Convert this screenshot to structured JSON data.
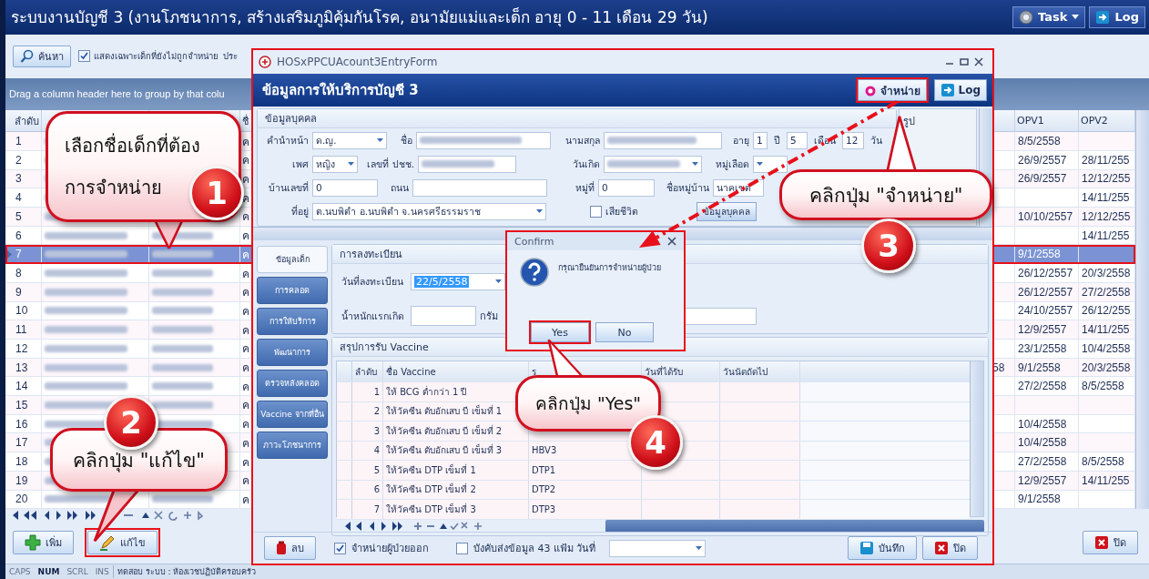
{
  "window": {
    "title": "ระบบงานบัญชี 3 (งานโภชนาการ, สร้างเสริมภูมิคุ้มกันโรค, อนามัยแม่และเด็ก อายุ 0 - 11 เดือน 29 วัน)",
    "buttons": [
      "Task",
      "Log"
    ]
  },
  "toolbar": {
    "search_button": "ค้นหา",
    "filter_checkbox": {
      "label": "แสดงเฉพาะเด็กที่ยังไม่ถูกจำหน่าย",
      "checked": true
    },
    "cut_label": "ประ"
  },
  "group_panel": "Drag a column header here to group by that colu",
  "grid": {
    "columns": [
      "ลำดับ",
      "ชื่",
      "OPV1",
      "OPV2"
    ],
    "rows": [
      {
        "no": "1",
        "column_4": "ค",
        "opv1": "8/5/2558",
        "selected": false
      },
      {
        "no": "2",
        "column_4": "ค",
        "opv1": "26/9/2557",
        "opv2": "28/11/255",
        "selected": false
      },
      {
        "no": "3",
        "column_4": "ค",
        "opv1": "26/9/2557",
        "opv2": "12/12/255",
        "selected": false
      },
      {
        "no": "4",
        "column_4": "ค",
        "opv2": "14/11/255",
        "selected": false
      },
      {
        "no": "5",
        "column_4": "ค",
        "opv1": "10/10/2557",
        "opv2": "12/12/255",
        "selected": false
      },
      {
        "no": "6",
        "column_4": "ค",
        "opv2": "14/11/255",
        "selected": false
      },
      {
        "no": "7",
        "column_4": "ค",
        "opv1": "9/1/2558",
        "selected": true
      },
      {
        "no": "8",
        "column_4": "ค",
        "opv1": "26/12/2557",
        "opv2": "20/3/2558",
        "selected": false
      },
      {
        "no": "9",
        "column_4": "ค",
        "opv1": "26/12/2557",
        "opv2": "27/2/2558",
        "selected": false
      },
      {
        "no": "10",
        "column_4": "ค",
        "opv1": "24/10/2557",
        "opv2": "26/12/255",
        "selected": false
      },
      {
        "no": "11",
        "column_4": "ค",
        "opv1": "12/9/2557",
        "opv2": "14/11/255",
        "selected": false
      },
      {
        "no": "12",
        "column_4": "ค",
        "opv1": "23/1/2558",
        "opv2": "10/4/2558",
        "selected": false
      },
      {
        "no": "13",
        "column_4": "ค",
        "column_5": "58",
        "opv1": "9/1/2558",
        "opv2": "20/3/2558",
        "selected": false
      },
      {
        "no": "14",
        "column_4": "ค",
        "opv1": "27/2/2558",
        "opv2": "8/5/2558",
        "selected": false
      },
      {
        "no": "15",
        "column_4": "ค",
        "selected": false
      },
      {
        "no": "16",
        "column_4": "ค",
        "opv1": "10/4/2558",
        "selected": false
      },
      {
        "no": "17",
        "column_4": "ค",
        "opv1": "10/4/2558",
        "selected": false
      },
      {
        "no": "18",
        "column_4": "ค",
        "opv1": "27/2/2558",
        "opv2": "8/5/2558",
        "selected": false
      },
      {
        "no": "19",
        "column_4": "ค",
        "opv1": "12/9/2557",
        "opv2": "14/11/255",
        "selected": false
      },
      {
        "no": "20",
        "column_4": "ค",
        "opv1": "9/1/2558",
        "selected": false
      }
    ]
  },
  "bottom_buttons": {
    "add": "เพิ่ม",
    "edit": "แก้ไข",
    "close": "ปิด"
  },
  "status_bar": {
    "keys": [
      {
        "label": "CAPS",
        "on": false
      },
      {
        "label": "NUM",
        "on": true
      },
      {
        "label": "SCRL",
        "on": false
      },
      {
        "label": "INS",
        "on": false
      }
    ],
    "text": "ทดสอบ ระบบ : ห้องเวชปฏิบัติครอบครัว"
  },
  "dialog": {
    "title": "HOSxPPCUAcount3EntryForm",
    "header": "ข้อมูลการให้บริการบัญชี 3",
    "header_buttons": [
      "จำหน่าย",
      "Log"
    ],
    "person": {
      "title": "ข้อมูลบุคคล",
      "fields": [
        {
          "label": "คำนำหน้า",
          "kind": "combo",
          "value": "ด.ญ."
        },
        {
          "label": "ชื่อ",
          "kind": "blurred"
        },
        {
          "label": "นามสกุล",
          "kind": "blurred"
        },
        {
          "label": "อายุ",
          "kind": "text",
          "value": "1",
          "unit": "ปี"
        },
        {
          "kind": "text",
          "value": "5",
          "unit": "เดือน"
        },
        {
          "kind": "text",
          "value": "12",
          "unit": "วัน"
        },
        {
          "label": "เพศ",
          "kind": "combo",
          "value": "หญิง"
        },
        {
          "label": "เลขที่ ปชช.",
          "kind": "blurred"
        },
        {
          "label": "วันเกิด",
          "kind": "blurred_combo"
        },
        {
          "label": "หมู่เลือด",
          "kind": "combo"
        },
        {
          "label": "บ้านเลขที่",
          "kind": "text",
          "value": "0"
        },
        {
          "label": "ถนน",
          "kind": "text"
        },
        {
          "label": "หมู่ที่",
          "kind": "text",
          "value": "0"
        },
        {
          "label": "ชื่อหมู่บ้าน",
          "kind": "text",
          "value": "นาคเขต"
        },
        {
          "label": "ที่อยู่",
          "kind": "combo",
          "value": "ต.นบพิตำ อ.นบพิตำ จ.นครศรีธรรมราช"
        },
        {
          "label": "เสียชีวิต",
          "kind": "checkbox",
          "checked": false
        },
        {
          "label": "ข้อมูลบุคคล",
          "kind": "button"
        }
      ]
    },
    "photo_label": "รูป",
    "tabs": [
      {
        "label": "ข้อมูลเด็ก",
        "selected": true
      },
      {
        "label": "การคลอด",
        "selected": false
      },
      {
        "label": "การให้บริการ",
        "selected": false
      },
      {
        "label": "พัฒนาการ",
        "selected": false
      },
      {
        "label": "ตรวจหลังคลอด",
        "selected": false
      },
      {
        "label": "Vaccine จากที่อื่น",
        "selected": false
      },
      {
        "label": "ภาวะโภชนาการ",
        "selected": false
      }
    ],
    "registration": {
      "title": "การลงทะเบียน",
      "date_label": "วันที่ลงทะเบียน",
      "date_value": "22/5/2558",
      "weight_label": "น้ำหนักแรกเกิด",
      "weight_unit": "กรัม"
    },
    "vaccine": {
      "title": "สรุปการรับ Vaccine",
      "columns": [
        "ลำดับ",
        "ชื่อ Vaccine",
        "ร",
        "วันที่ได้รับ",
        "วันนัดถัดไป"
      ],
      "rows": [
        {
          "no": "1",
          "name": "ให้ BCG ต่ำกว่า 1 ปี"
        },
        {
          "no": "2",
          "name": "ให้วัคซีน ตับอักเสบ บี เข็มที่ 1"
        },
        {
          "no": "3",
          "name": "ให้วัคซีน ตับอักเสบ บี เข็มที่ 2"
        },
        {
          "no": "4",
          "name": "ให้วัคซีน ตับอักเสบ บี เข็มที่ 3",
          "code": "HBV3"
        },
        {
          "no": "5",
          "name": "ให้วัคซีน DTP เข็มที่ 1",
          "code": "DTP1"
        },
        {
          "no": "6",
          "name": "ให้วัคซีน DTP เข็มที่ 2",
          "code": "DTP2"
        },
        {
          "no": "7",
          "name": "ให้วัคซีน DTP เข็มที่ 3",
          "code": "DTP3"
        }
      ]
    },
    "footer": {
      "delete": "ลบ",
      "discharge_checkbox": {
        "label": "จำหน่ายผู้ป่วยออก",
        "checked": true
      },
      "send_checkbox": {
        "label": "บังคับส่งข้อมูล 43 แฟ้ม วันที่",
        "checked": false
      },
      "save": "บันทึก",
      "close": "ปิด"
    }
  },
  "confirm": {
    "title": "Confirm",
    "message": "กรุณายืนยันการจำหน่ายผู้ป่วย",
    "buttons": [
      "Yes",
      "No"
    ]
  },
  "callouts": [
    {
      "lines": [
        "เลือกชื่อเด็กที่ต้อง",
        "การจำหน่าย"
      ],
      "number": "1"
    },
    {
      "lines": [
        "คลิกปุ่ม \"แก้ไข\""
      ],
      "number": "2"
    },
    {
      "lines": [
        "คลิกปุ่ม \"จำหน่าย\""
      ],
      "number": "3"
    },
    {
      "lines": [
        "คลิกปุ่ม \"Yes\""
      ],
      "number": "4"
    }
  ]
}
